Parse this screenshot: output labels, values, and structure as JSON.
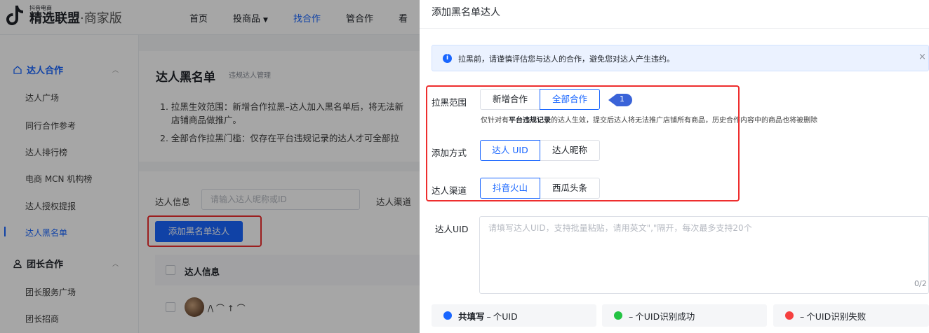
{
  "brand": {
    "small": "抖音电商",
    "name": "精选联盟",
    "edition": "·商家版"
  },
  "nav": [
    {
      "label": "首页",
      "active": false,
      "caret": false
    },
    {
      "label": "投商品",
      "active": false,
      "caret": true
    },
    {
      "label": "找合作",
      "active": true,
      "caret": false
    },
    {
      "label": "管合作",
      "active": false,
      "caret": false
    },
    {
      "label": "看",
      "active": false,
      "caret": false
    }
  ],
  "sidebar": {
    "group1": "达人合作",
    "group1_items": [
      "达人广场",
      "同行合作参考",
      "达人排行榜",
      "电商 MCN 机构榜",
      "达人授权提报",
      "达人黑名单"
    ],
    "group2": "团长合作",
    "group2_items": [
      "团长服务广场",
      "团长招商"
    ]
  },
  "page": {
    "title": "达人黑名单",
    "subtitle": "违规达人管理",
    "rules": [
      "1. 拉黑生效范围：新增合作拉黑–达人加入黑名单后，将无法新",
      "店铺商品做推广。",
      "2. 全部合作拉黑门槛：仅存在平台违规记录的达人才可全部拉"
    ],
    "filter_label": "达人信息",
    "filter_placeholder": "请输入达人昵称或ID",
    "channel_label": "达人渠道",
    "add_button": "添加黑名单达人",
    "table_header": "达人信息",
    "row_name": "/\\ ⌒ ↑ ⌒"
  },
  "drawer": {
    "title": "添加黑名单达人",
    "alert": "拉黑前，请谨慎评估您与达人的合作，避免您对达人产生违约。",
    "alert_close": "×",
    "scope": {
      "label": "拉黑范围",
      "options": [
        "新增合作",
        "全部合作"
      ],
      "selected": "全部合作"
    },
    "hint_pre": "仅针对有",
    "hint_bold": "平台违规记录",
    "hint_post": "的达人生效，提交后达人将无法推广店铺所有商品，历史合作内容中的商品也将被删除",
    "callout": "1",
    "method": {
      "label": "添加方式",
      "options": [
        "达人 UID",
        "达人昵称"
      ],
      "selected": "达人 UID"
    },
    "channel": {
      "label": "达人渠道",
      "options": [
        "抖音火山",
        "西瓜头条"
      ],
      "selected": "抖音火山"
    },
    "uid_label": "达人UID",
    "uid_placeholder": "请填写达人UID，支持批量粘贴，请用英文\",\"隔开，每次最多支持20个",
    "uid_count": "0/2",
    "stats": [
      {
        "bold": "共填写",
        "rest": "个UID",
        "color": "#1966ff"
      },
      {
        "bold": "",
        "rest": "个UID识别成功",
        "color": "#23c343"
      },
      {
        "bold": "",
        "rest": "个UID识别失败",
        "color": "#f53f3f"
      }
    ],
    "dash": "–"
  },
  "colors": {
    "accent": "#1966ff",
    "highlight": "#ee2e2e",
    "success": "#23c343",
    "error": "#f53f3f"
  }
}
